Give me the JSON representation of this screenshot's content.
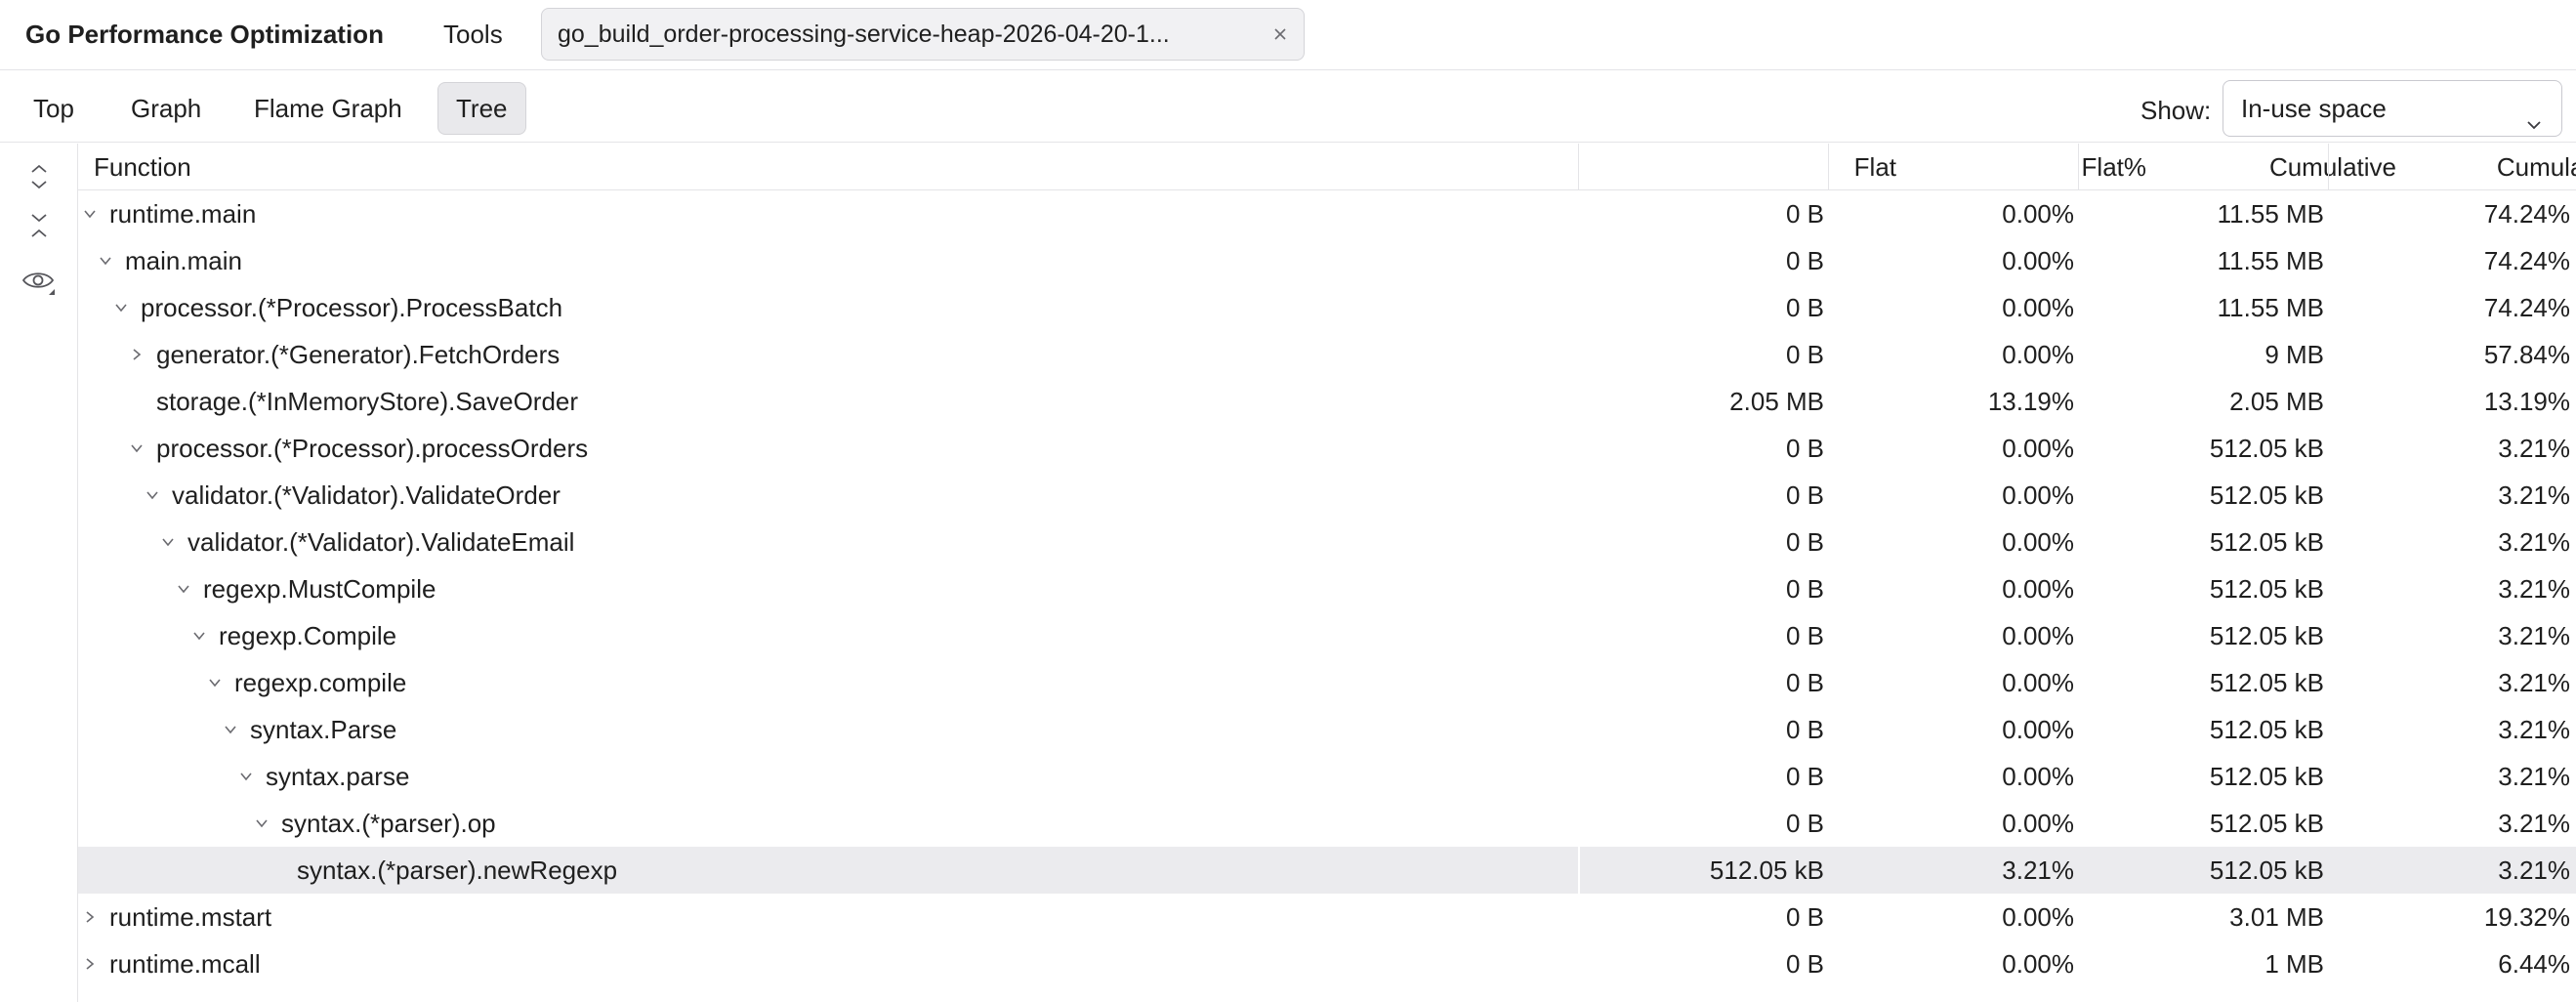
{
  "app": {
    "title": "Go Performance Optimization",
    "tools_label": "Tools"
  },
  "file_tab": {
    "label": "go_build_order-processing-service-heap-2026-04-20-1..."
  },
  "view_tabs": [
    {
      "label": "Top",
      "active": false
    },
    {
      "label": "Graph",
      "active": false
    },
    {
      "label": "Flame Graph",
      "active": false
    },
    {
      "label": "Tree",
      "active": true
    }
  ],
  "show": {
    "label": "Show:",
    "selected": "In-use space"
  },
  "icons": {
    "expand_all": "expand-all-icon",
    "collapse_all": "collapse-all-icon",
    "view_options": "eye-icon",
    "close": "close-icon",
    "chevron": "chevron-down-icon"
  },
  "colors": {
    "selected_row": "#ebebee",
    "active_tab": "#e9e9ec",
    "border": "#e4e4e7"
  },
  "table": {
    "columns": {
      "function": "Function",
      "flat": "Flat",
      "flat_pct": "Flat%",
      "cumulative": "Cumulative",
      "cumulative_pct": "Cumulative%"
    },
    "rows": [
      {
        "depth": 0,
        "state": "expanded",
        "name": "runtime.main",
        "flat": "0 B",
        "flat_pct": "0.00%",
        "cum": "11.55 MB",
        "cum_pct": "74.24%",
        "selected": false
      },
      {
        "depth": 1,
        "state": "expanded",
        "name": "main.main",
        "flat": "0 B",
        "flat_pct": "0.00%",
        "cum": "11.55 MB",
        "cum_pct": "74.24%",
        "selected": false
      },
      {
        "depth": 2,
        "state": "expanded",
        "name": "processor.(*Processor).ProcessBatch",
        "flat": "0 B",
        "flat_pct": "0.00%",
        "cum": "11.55 MB",
        "cum_pct": "74.24%",
        "selected": false
      },
      {
        "depth": 3,
        "state": "collapsed",
        "name": "generator.(*Generator).FetchOrders",
        "flat": "0 B",
        "flat_pct": "0.00%",
        "cum": "9 MB",
        "cum_pct": "57.84%",
        "selected": false
      },
      {
        "depth": 3,
        "state": "leaf",
        "name": "storage.(*InMemoryStore).SaveOrder",
        "flat": "2.05 MB",
        "flat_pct": "13.19%",
        "cum": "2.05 MB",
        "cum_pct": "13.19%",
        "selected": false
      },
      {
        "depth": 3,
        "state": "expanded",
        "name": "processor.(*Processor).processOrders",
        "flat": "0 B",
        "flat_pct": "0.00%",
        "cum": "512.05 kB",
        "cum_pct": "3.21%",
        "selected": false
      },
      {
        "depth": 4,
        "state": "expanded",
        "name": "validator.(*Validator).ValidateOrder",
        "flat": "0 B",
        "flat_pct": "0.00%",
        "cum": "512.05 kB",
        "cum_pct": "3.21%",
        "selected": false
      },
      {
        "depth": 5,
        "state": "expanded",
        "name": "validator.(*Validator).ValidateEmail",
        "flat": "0 B",
        "flat_pct": "0.00%",
        "cum": "512.05 kB",
        "cum_pct": "3.21%",
        "selected": false
      },
      {
        "depth": 6,
        "state": "expanded",
        "name": "regexp.MustCompile",
        "flat": "0 B",
        "flat_pct": "0.00%",
        "cum": "512.05 kB",
        "cum_pct": "3.21%",
        "selected": false
      },
      {
        "depth": 7,
        "state": "expanded",
        "name": "regexp.Compile",
        "flat": "0 B",
        "flat_pct": "0.00%",
        "cum": "512.05 kB",
        "cum_pct": "3.21%",
        "selected": false
      },
      {
        "depth": 8,
        "state": "expanded",
        "name": "regexp.compile",
        "flat": "0 B",
        "flat_pct": "0.00%",
        "cum": "512.05 kB",
        "cum_pct": "3.21%",
        "selected": false
      },
      {
        "depth": 9,
        "state": "expanded",
        "name": "syntax.Parse",
        "flat": "0 B",
        "flat_pct": "0.00%",
        "cum": "512.05 kB",
        "cum_pct": "3.21%",
        "selected": false
      },
      {
        "depth": 10,
        "state": "expanded",
        "name": "syntax.parse",
        "flat": "0 B",
        "flat_pct": "0.00%",
        "cum": "512.05 kB",
        "cum_pct": "3.21%",
        "selected": false
      },
      {
        "depth": 11,
        "state": "expanded",
        "name": "syntax.(*parser).op",
        "flat": "0 B",
        "flat_pct": "0.00%",
        "cum": "512.05 kB",
        "cum_pct": "3.21%",
        "selected": false
      },
      {
        "depth": 12,
        "state": "leaf",
        "name": "syntax.(*parser).newRegexp",
        "flat": "512.05 kB",
        "flat_pct": "3.21%",
        "cum": "512.05 kB",
        "cum_pct": "3.21%",
        "selected": true
      },
      {
        "depth": 0,
        "state": "collapsed",
        "name": "runtime.mstart",
        "flat": "0 B",
        "flat_pct": "0.00%",
        "cum": "3.01 MB",
        "cum_pct": "19.32%",
        "selected": false
      },
      {
        "depth": 0,
        "state": "collapsed",
        "name": "runtime.mcall",
        "flat": "0 B",
        "flat_pct": "0.00%",
        "cum": "1 MB",
        "cum_pct": "6.44%",
        "selected": false
      }
    ]
  }
}
